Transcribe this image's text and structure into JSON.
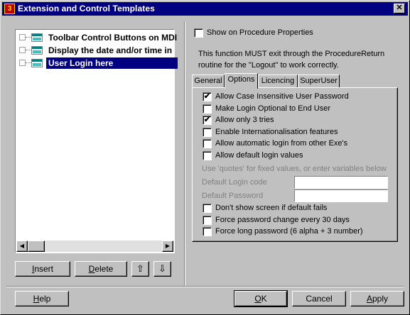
{
  "window": {
    "title": "Extension and Control Templates",
    "close_glyph": "✕"
  },
  "tree": {
    "items": [
      {
        "label": "Toolbar Control Buttons on MDI"
      },
      {
        "label": "Display the date and/or time in"
      },
      {
        "label": "User Login here"
      }
    ],
    "selected_index": 2
  },
  "left_buttons": {
    "insert": "Insert",
    "delete": "Delete"
  },
  "show_on_procedure": {
    "label": "Show on Procedure Properties",
    "checked": false
  },
  "info_text": "This function MUST exit through the ProcedureReturn routine for the \"Logout\" to work correctly.",
  "tabs": [
    {
      "label": "General"
    },
    {
      "label": "Options"
    },
    {
      "label": "Licencing"
    },
    {
      "label": "SuperUser"
    }
  ],
  "active_tab": 1,
  "options": [
    {
      "label": "Allow Case Insensitive User Password",
      "checked": true
    },
    {
      "label": "Make Login Optional to End User",
      "checked": false
    },
    {
      "label": "Allow only 3 tries",
      "checked": true
    },
    {
      "label": "Enable Internationalisation features",
      "checked": false
    },
    {
      "label": "Allow automatic login from other Exe's",
      "checked": false
    },
    {
      "label": "Allow default login values",
      "checked": false
    }
  ],
  "defaults": {
    "hint": "Use 'quotes' for fixed values, or enter variables below",
    "login_code_label": "Default Login code",
    "login_code_value": "",
    "password_label": "Default Password",
    "password_value": ""
  },
  "options_bottom": [
    {
      "label": "Don't show screen if default fails",
      "checked": false
    },
    {
      "label": "Force password change every 30 days",
      "checked": false
    },
    {
      "label": "Force long password (6 alpha + 3 number)",
      "checked": false
    }
  ],
  "footer": {
    "help": "Help",
    "ok": "OK",
    "cancel": "Cancel",
    "apply": "Apply"
  },
  "icons": {
    "check": "✔",
    "up_arrow": "⇧",
    "down_arrow": "⇩"
  }
}
